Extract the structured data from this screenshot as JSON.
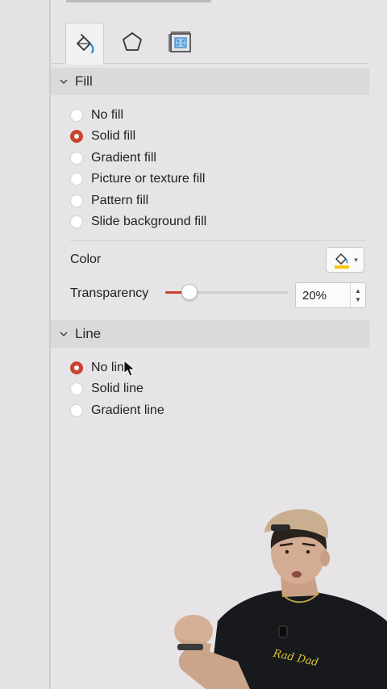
{
  "tabs": [
    {
      "name": "fill-and-line",
      "icon": "paint-bucket-icon",
      "active": true
    },
    {
      "name": "effects",
      "icon": "pentagon-icon",
      "active": false
    },
    {
      "name": "size-and-properties",
      "icon": "size-properties-icon",
      "active": false
    }
  ],
  "fill": {
    "title": "Fill",
    "options": [
      "No fill",
      "Solid fill",
      "Gradient fill",
      "Picture or texture fill",
      "Pattern fill",
      "Slide background fill"
    ],
    "selected_index": 1,
    "color_label": "Color",
    "color_swatch": "#f2c811",
    "transparency_label": "Transparency",
    "transparency_value": "20%",
    "transparency_fraction": 0.2
  },
  "line": {
    "title": "Line",
    "options": [
      "No line",
      "Solid line",
      "Gradient line"
    ],
    "selected_index": 0
  },
  "colors": {
    "accent": "#c9432b",
    "panel_bg": "#e6e4e6",
    "header_bg": "#dbd9db"
  },
  "overlay_shirt_text": "Rad Dad"
}
